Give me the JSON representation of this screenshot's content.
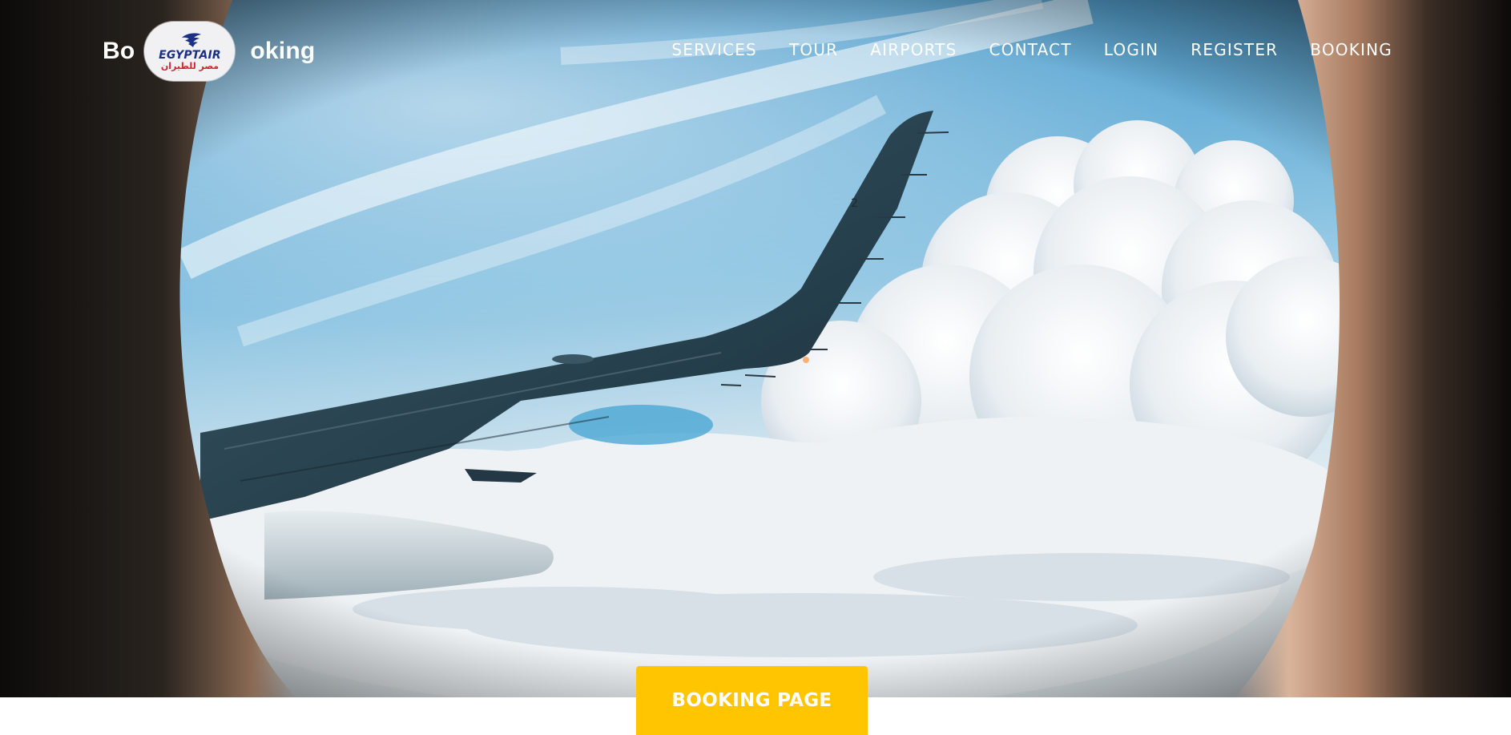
{
  "brand": {
    "text_left": "Bo",
    "text_right": "oking",
    "logo_text": "EGYPTAIR",
    "logo_arabic": "مصر للطيران",
    "logo_colors": {
      "blue": "#1c2f86",
      "red": "#d3232f"
    }
  },
  "nav": {
    "items": [
      {
        "label": "SERVICES"
      },
      {
        "label": "TOUR"
      },
      {
        "label": "AIRPORTS"
      },
      {
        "label": "CONTACT"
      },
      {
        "label": "LOGIN"
      },
      {
        "label": "REGISTER"
      },
      {
        "label": "BOOKING"
      }
    ]
  },
  "hero": {
    "image_subject": "airplane-wing-through-window",
    "wing_marking": "2"
  },
  "cta": {
    "label": "BOOKING PAGE",
    "color": "#ffc600"
  }
}
